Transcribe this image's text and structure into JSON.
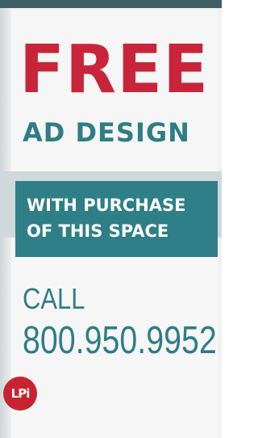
{
  "ad": {
    "headline": "FREE",
    "subheadline": "AD DESIGN",
    "band_line1": "WITH PURCHASE",
    "band_line2": "OF THIS SPACE",
    "call_label": "CALL",
    "phone": "800.950.9952",
    "logo_text": "LPi"
  },
  "colors": {
    "headline": "#c8253a",
    "accent": "#2f7d86",
    "band": "#2e7f87",
    "logo": "#c9232f"
  },
  "icons": {
    "logo": "lpi-logo"
  }
}
